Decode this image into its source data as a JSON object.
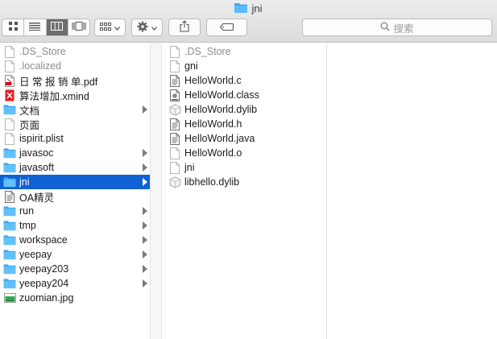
{
  "window": {
    "title": "jni"
  },
  "toolbar": {
    "search_placeholder": "搜索"
  },
  "colors": {
    "folder": "#3fa9f5",
    "selection": "#1161d6",
    "pdf_red": "#d0021b"
  },
  "column1": [
    {
      "name": ".DS_Store",
      "icon": "file-icon",
      "dim": true
    },
    {
      "name": ".localized",
      "icon": "file-icon",
      "dim": true
    },
    {
      "name": "日 常 报 销 单.pdf",
      "icon": "pdf-icon"
    },
    {
      "name": "算法增加.xmind",
      "icon": "xmind-icon"
    },
    {
      "name": "文档",
      "icon": "folder-icon",
      "folder": true
    },
    {
      "name": "页面",
      "icon": "file-icon"
    },
    {
      "name": "ispirit.plist",
      "icon": "file-icon"
    },
    {
      "name": "javasoc",
      "icon": "folder-icon",
      "folder": true
    },
    {
      "name": "javasoft",
      "icon": "folder-icon",
      "folder": true
    },
    {
      "name": "jni",
      "icon": "folder-icon",
      "folder": true,
      "selected": true
    },
    {
      "name": "OA精灵",
      "icon": "text-file-icon"
    },
    {
      "name": "run",
      "icon": "folder-icon",
      "folder": true
    },
    {
      "name": "tmp",
      "icon": "folder-icon",
      "folder": true
    },
    {
      "name": "workspace",
      "icon": "folder-icon",
      "folder": true
    },
    {
      "name": "yeepay",
      "icon": "folder-icon",
      "folder": true
    },
    {
      "name": "yeepay203",
      "icon": "folder-icon",
      "folder": true
    },
    {
      "name": "yeepay204",
      "icon": "folder-icon",
      "folder": true
    },
    {
      "name": "zuomian.jpg",
      "icon": "image-icon"
    }
  ],
  "column2": [
    {
      "name": ".DS_Store",
      "icon": "file-icon",
      "dim": true
    },
    {
      "name": "gni",
      "icon": "file-icon"
    },
    {
      "name": "HelloWorld.c",
      "icon": "text-file-icon"
    },
    {
      "name": "HelloWorld.class",
      "icon": "class-file-icon"
    },
    {
      "name": "HelloWorld.dylib",
      "icon": "dylib-icon"
    },
    {
      "name": "HelloWorld.h",
      "icon": "text-file-icon"
    },
    {
      "name": "HelloWorld.java",
      "icon": "text-file-icon"
    },
    {
      "name": "HelloWorld.o",
      "icon": "file-icon"
    },
    {
      "name": "jni",
      "icon": "file-icon"
    },
    {
      "name": "libhello.dylib",
      "icon": "dylib-icon"
    }
  ]
}
